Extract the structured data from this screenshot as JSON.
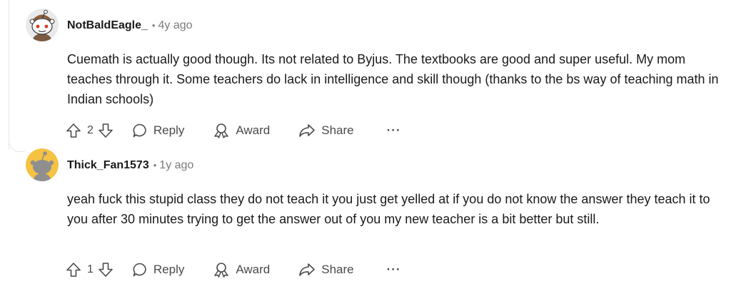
{
  "comments": [
    {
      "username": "NotBaldEagle_",
      "separator": "•",
      "age": "4y ago",
      "avatar_icon": "snoo-avatar-icon",
      "body": "Cuemath is actually good though. Its not related to Byjus. The textbooks are good and super useful. My mom teaches through it. Some teachers do lack in intelligence and skill though (thanks to the bs way of teaching math in Indian schools)",
      "votes": "2",
      "actions": {
        "reply": "Reply",
        "award": "Award",
        "share": "Share",
        "more": "···"
      }
    },
    {
      "username": "Thick_Fan1573",
      "separator": "•",
      "age": "1y ago",
      "avatar_icon": "snoo-avatar-icon",
      "body": "yeah fuck this stupid class they do not teach it you just get yelled at if you do not know the answer they teach it to you after 30 minutes trying to get the answer out of you my new teacher is a bit better but still.",
      "votes": "1",
      "actions": {
        "reply": "Reply",
        "award": "Award",
        "share": "Share",
        "more": "···"
      }
    }
  ],
  "colors": {
    "text": "#1a1a1b",
    "meta": "#7c7c7c",
    "icon": "#4a4a4a",
    "thread_line": "#e5e7e9",
    "avatar2_bg": "#f5c242"
  }
}
